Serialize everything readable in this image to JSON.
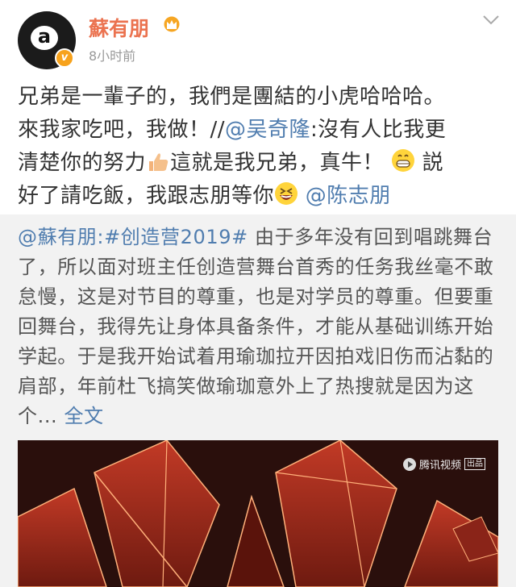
{
  "header": {
    "username": "蘇有朋",
    "avatar_letter": "a",
    "timestamp": "8小时前",
    "icons": [
      "crown-icon",
      "verified-icon",
      "chevron-down-icon"
    ],
    "username_color": "#eb7350"
  },
  "post": {
    "line1": "兄弟是一輩子的，我們是團結的小虎哈哈哈。",
    "line2_a": "來我家吃吧，我做！//",
    "line2_mention": "@吴奇隆",
    "line2_b": ":沒有人比我更",
    "line3_a": "清楚你的努力",
    "line3_b": "這就是我兄弟，真牛！",
    "line3_c": "説",
    "line4_a": "好了請吃飯，我跟志朋等你",
    "line4_mention": "@陈志朋"
  },
  "repost": {
    "mention": "@蘇有朋:#创造营2019#",
    "text": " 由于多年没有回到唱跳舞台了，所以面对班主任创造营舞台首秀的任务我丝毫不敢怠慢，这是对节目的尊重，也是对学员的尊重。但要重回舞台，我得先让身体具备条件，才能从基础训练开始学起。于是我开始试着用瑜珈拉开因拍戏旧伤而沾黏的肩部，年前杜飞搞笑做瑜珈意外上了热搜就是因为这个...",
    "full_text_link": "全文"
  },
  "video": {
    "watermark": "腾讯视频",
    "badge": "出品"
  },
  "colors": {
    "link": "#507daf",
    "repost_bg": "#f2f2f2",
    "video_bg": "#2a0f0c"
  }
}
